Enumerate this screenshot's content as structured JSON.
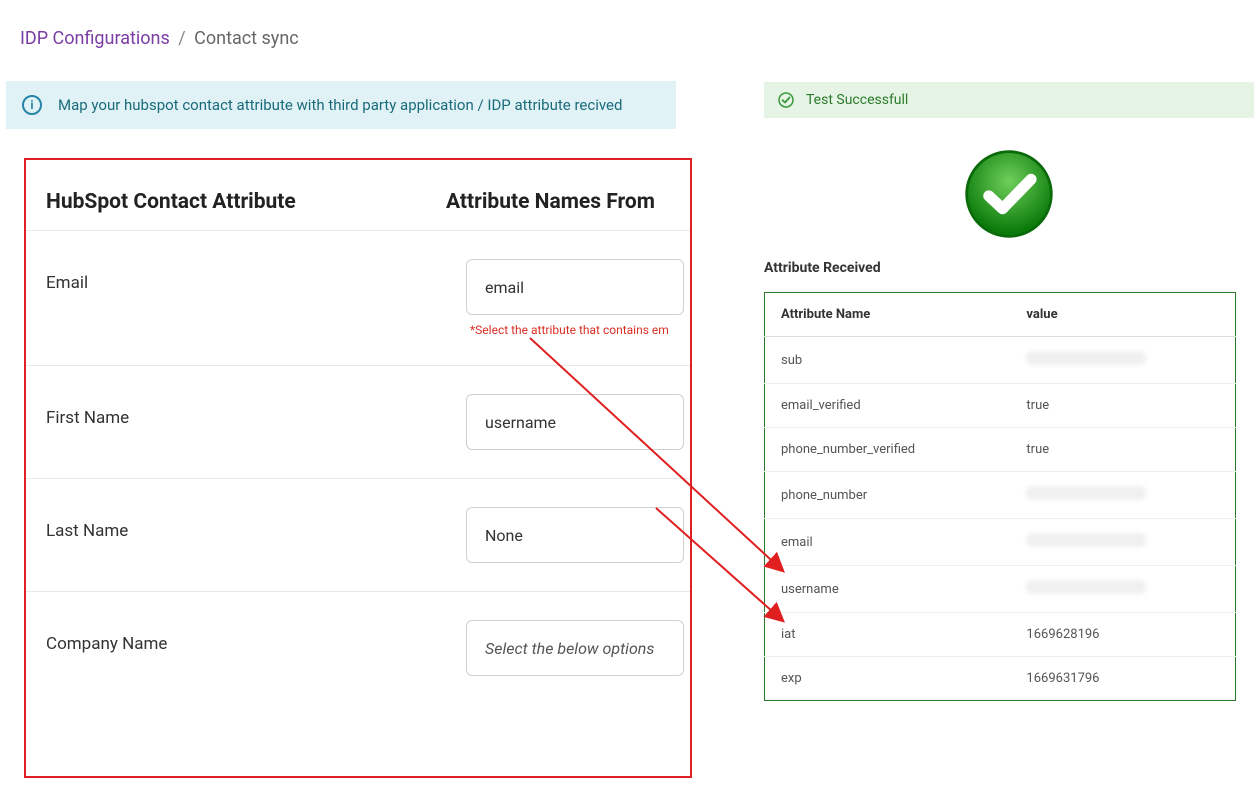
{
  "breadcrumb": {
    "parent": "IDP Configurations",
    "sep": "/",
    "current": "Contact sync"
  },
  "info_banner": "Map your hubspot contact attribute with third party application / IDP attribute recived",
  "mapping": {
    "header_col1": "HubSpot Contact Attribute",
    "header_col2": "Attribute Names From",
    "rows": [
      {
        "label": "Email",
        "value": "email",
        "helper": "*Select the attribute that contains em"
      },
      {
        "label": "First Name",
        "value": "username"
      },
      {
        "label": "Last Name",
        "value": "None"
      },
      {
        "label": "Company Name",
        "placeholder": "Select the below options"
      }
    ]
  },
  "test": {
    "success_label": "Test Successfull",
    "attr_received_title": "Attribute Received",
    "table_headers": {
      "name": "Attribute Name",
      "value": "value"
    },
    "attributes": [
      {
        "name": "sub",
        "value": "",
        "blur": true
      },
      {
        "name": "email_verified",
        "value": "true"
      },
      {
        "name": "phone_number_verified",
        "value": "true"
      },
      {
        "name": "phone_number",
        "value": "",
        "blur": true
      },
      {
        "name": "email",
        "value": "",
        "blur": true
      },
      {
        "name": "username",
        "value": "",
        "blur": true
      },
      {
        "name": "iat",
        "value": "1669628196"
      },
      {
        "name": "exp",
        "value": "1669631796"
      }
    ]
  }
}
